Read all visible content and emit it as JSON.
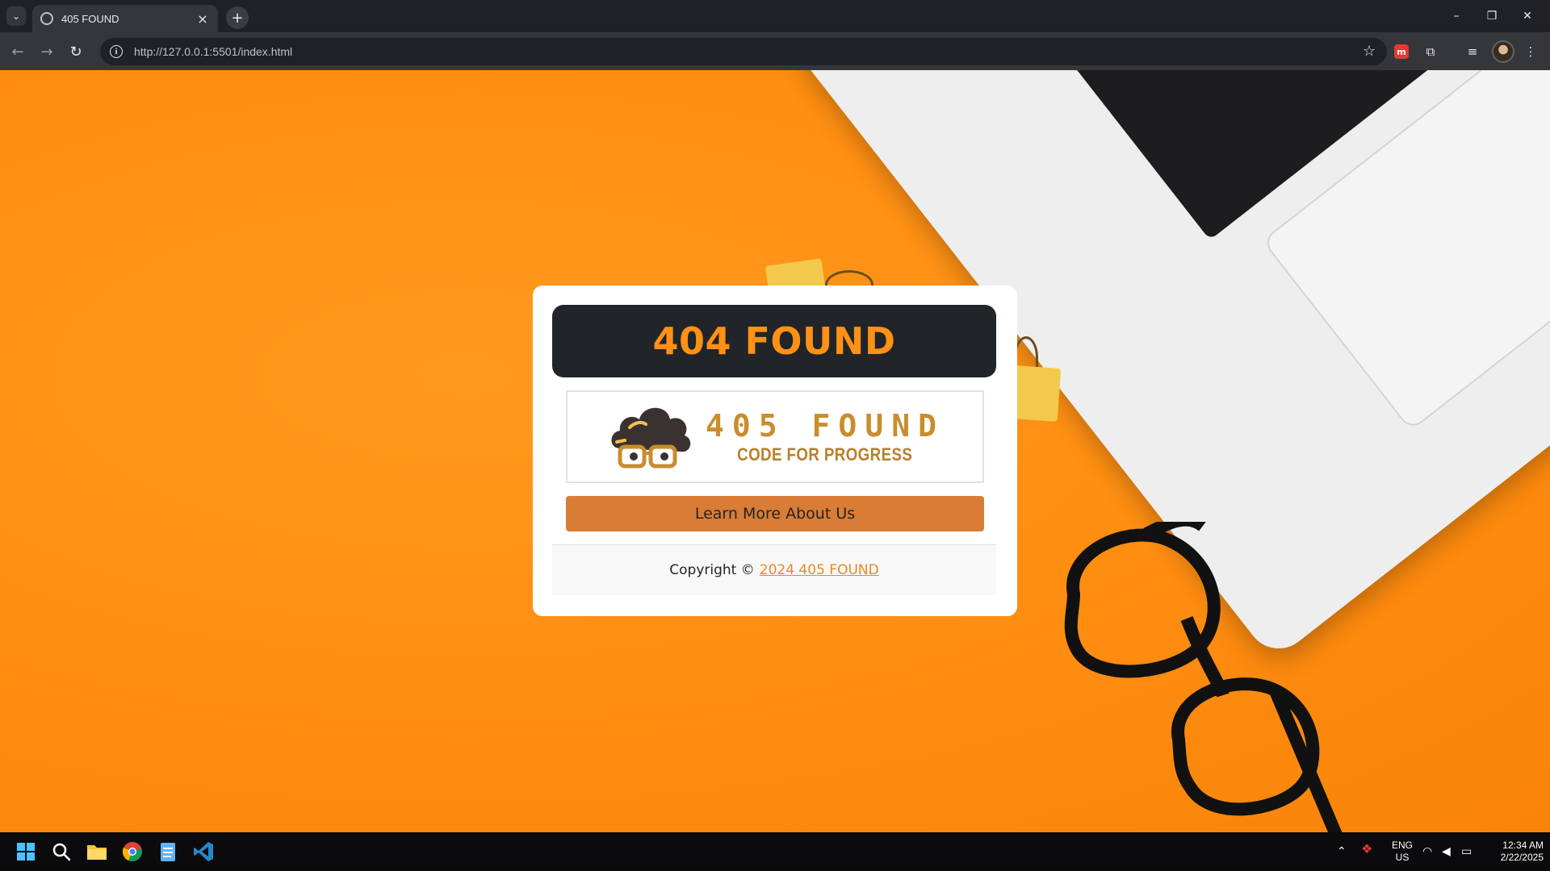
{
  "browser": {
    "tab_title": "405 FOUND",
    "new_tab_symbol": "+",
    "url": "http://127.0.0.1:5501/index.html"
  },
  "card": {
    "title": "404 FOUND",
    "logo": {
      "name": "405 FOUND",
      "tagline": "CODE FOR PROGRESS"
    },
    "learn_more_label": "Learn More About Us",
    "footer": {
      "copyright_prefix": "Copyright ©",
      "link_text": "2024 405 FOUND"
    }
  },
  "taskbar": {
    "language": "ENG",
    "region": "US",
    "time": "12:34 AM",
    "date": "2/22/2025"
  },
  "colors": {
    "background_orange": "#ff8f12",
    "title_bar": "#212529",
    "title_text": "#ff9116",
    "button": "#d97c35",
    "link": "#e8892b"
  },
  "icons": [
    "tab-search-icon",
    "globe-favicon-icon",
    "close-icon",
    "back-icon",
    "forward-icon",
    "reload-icon",
    "info-icon",
    "star-icon",
    "extensions-icon",
    "media-icon",
    "menu-icon",
    "windows-start-icon",
    "search-icon",
    "file-explorer-icon",
    "chrome-icon",
    "notepad-icon",
    "vscode-icon",
    "wifi-icon",
    "volume-icon",
    "battery-icon"
  ]
}
